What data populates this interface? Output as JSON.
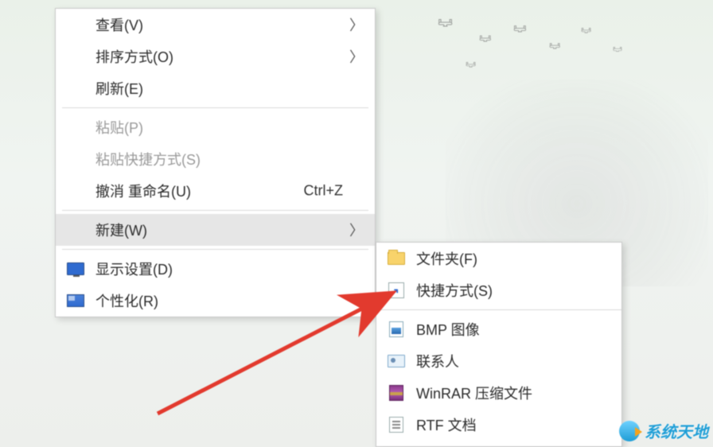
{
  "contextMenu": {
    "items": [
      {
        "label": "查看(V)",
        "submenu": true
      },
      {
        "label": "排序方式(O)",
        "submenu": true
      },
      {
        "label": "刷新(E)"
      }
    ],
    "pasteGroup": [
      {
        "label": "粘贴(P)",
        "disabled": true
      },
      {
        "label": "粘贴快捷方式(S)",
        "disabled": true
      },
      {
        "label": "撤消 重命名(U)",
        "shortcut": "Ctrl+Z"
      }
    ],
    "newItem": {
      "label": "新建(W)",
      "submenu": true,
      "highlight": true
    },
    "settingsGroup": [
      {
        "label": "显示设置(D)",
        "iconName": "monitor-icon"
      },
      {
        "label": "个性化(R)",
        "iconName": "personalize-icon"
      }
    ]
  },
  "newSubmenu": {
    "items": [
      {
        "label": "文件夹(F)",
        "iconName": "folder-icon"
      },
      {
        "label": "快捷方式(S)",
        "iconName": "shortcut-icon"
      }
    ],
    "fileTypes": [
      {
        "label": "BMP 图像",
        "iconName": "bmp-icon"
      },
      {
        "label": "联系人",
        "iconName": "contact-icon"
      },
      {
        "label": "WinRAR 压缩文件",
        "iconName": "rar-icon"
      },
      {
        "label": "RTF 文档",
        "iconName": "rtf-icon"
      }
    ]
  },
  "watermark": {
    "text": "系统天地"
  }
}
